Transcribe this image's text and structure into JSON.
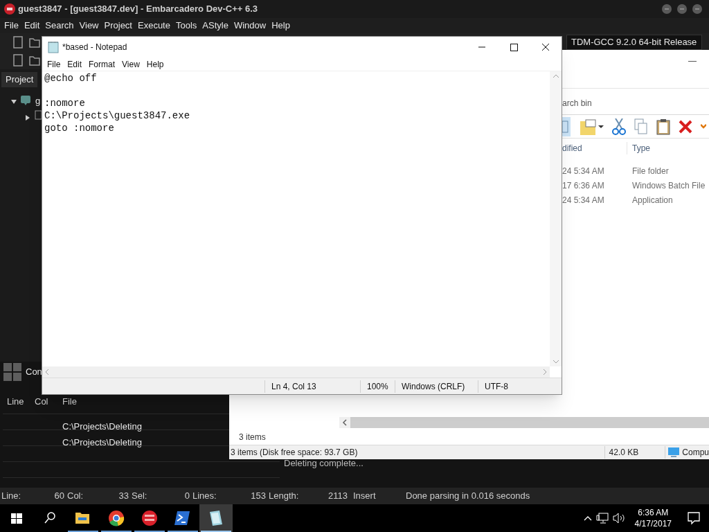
{
  "devcpp": {
    "title": "guest3847 - [guest3847.dev] - Embarcadero Dev-C++ 6.3",
    "menu": [
      "File",
      "Edit",
      "Search",
      "View",
      "Project",
      "Execute",
      "Tools",
      "AStyle",
      "Window",
      "Help"
    ],
    "compiler": "TDM-GCC 9.2.0 64-bit Release",
    "project_tab": "Project",
    "tree_label": "g",
    "bottom_tab": "Con",
    "columns": [
      "Line",
      "Col",
      "File"
    ],
    "rows": [
      {
        "file": "C:\\Projects\\Deleting"
      },
      {
        "file": "C:\\Projects\\Deleting"
      }
    ],
    "log_text": "Deleting complete...",
    "status_bar": [
      {
        "label": "Line:",
        "value": "60"
      },
      {
        "label": "Col:",
        "value": "33"
      },
      {
        "label": "Sel:",
        "value": "0"
      },
      {
        "label": "Lines:",
        "value": "153"
      },
      {
        "label": "Length:",
        "value": "2113"
      }
    ],
    "mode": "Insert",
    "status_message": "Done parsing in 0.016 seconds"
  },
  "explorer": {
    "search_text": "arch bin",
    "columns": [
      "dified",
      "Type"
    ],
    "rows": [
      {
        "modified": "24 5:34 AM",
        "type": "File folder"
      },
      {
        "modified": "17 6:36 AM",
        "type": "Windows Batch File"
      },
      {
        "modified": "24 5:34 AM",
        "type": "Application"
      }
    ],
    "item_count": "3 items",
    "status": "3 items (Disk free space: 93.7 GB)",
    "size": "42.0 KB",
    "location": "Compu"
  },
  "notepad": {
    "title": "*based - Notepad",
    "menu": [
      "File",
      "Edit",
      "Format",
      "View",
      "Help"
    ],
    "lines": [
      {
        "kind": "text",
        "text": "@echo off"
      },
      {
        "kind": "blank"
      },
      {
        "kind": "text",
        "text": ":nomore"
      },
      {
        "kind": "text",
        "text": "C:\\Projects\\guest3847.exe"
      },
      {
        "kind": "text",
        "text": "goto :nomore"
      }
    ],
    "status": [
      "Ln 4, Col 13",
      "100%",
      "Windows (CRLF)",
      "UTF-8"
    ]
  },
  "taskbar": {
    "apps": [
      {
        "kind": "files",
        "selected": false
      },
      {
        "kind": "browser",
        "selected": false
      },
      {
        "kind": "ide",
        "selected": false
      },
      {
        "kind": "shell",
        "selected": false
      },
      {
        "kind": "notepad",
        "selected": true
      }
    ],
    "time": "6:36 AM",
    "date": "4/17/2017"
  }
}
